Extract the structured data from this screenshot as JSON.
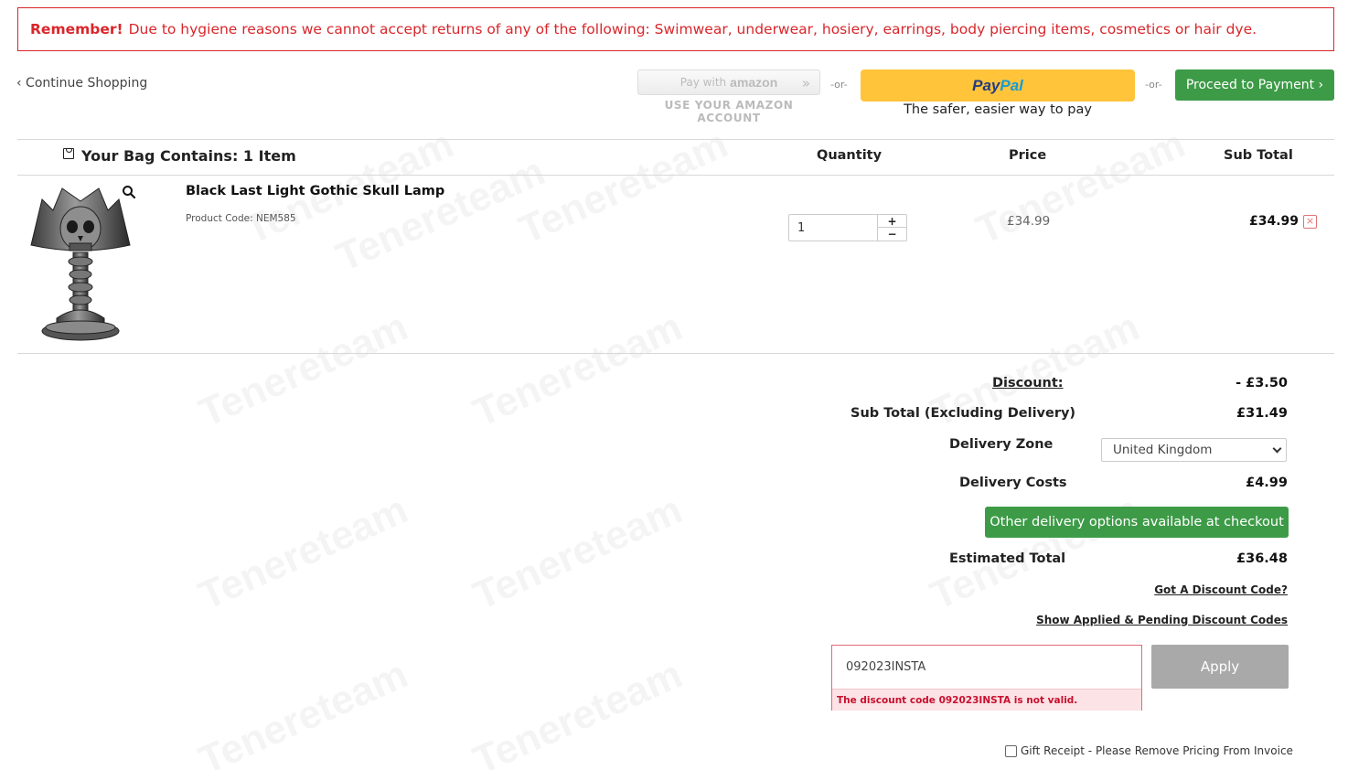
{
  "notice": {
    "bold": "Remember!",
    "text": "Due to hygiene reasons we cannot accept returns of any of the following: Swimwear, underwear, hosiery, earrings, body piercing items, cosmetics or hair dye."
  },
  "nav": {
    "continue_label": "‹ Continue Shopping"
  },
  "payment": {
    "amazon_prefix": "Pay with",
    "amazon_brand": "amazon",
    "amazon_caption": "USE YOUR AMAZON ACCOUNT",
    "or_label": "-or-",
    "paypal_pay": "Pay",
    "paypal_pal": "Pal",
    "paypal_caption": "The safer, easier way to pay",
    "proceed_label": "Proceed to Payment ›"
  },
  "bag": {
    "title": "Your Bag Contains: 1 Item",
    "col_quantity": "Quantity",
    "col_price": "Price",
    "col_subtotal": "Sub Total"
  },
  "item": {
    "name": "Black Last Light Gothic Skull Lamp",
    "code_label": "Product Code: NEM585",
    "quantity": "1",
    "price": "£34.99",
    "subtotal": "£34.99",
    "remove_icon": "×"
  },
  "summary": {
    "discount_label": "Discount:",
    "discount_value": "- £3.50",
    "subtotal_label": "Sub Total (Excluding Delivery)",
    "subtotal_value": "£31.49",
    "zone_label": "Delivery Zone",
    "zone_selected": "United Kingdom",
    "costs_label": "Delivery Costs",
    "costs_value": "£4.99",
    "other_delivery_label": "Other delivery options available at checkout",
    "estimated_label": "Estimated Total",
    "estimated_value": "£36.48"
  },
  "discount": {
    "got_code_link": "Got A Discount Code?",
    "show_applied_link": "Show Applied & Pending Discount Codes",
    "code_value": "092023INSTA",
    "error": "The discount code 092023INSTA is not valid.",
    "apply_label": "Apply"
  },
  "gift": {
    "label": "Gift Receipt - Please Remove Pricing From Invoice"
  },
  "watermark": {
    "text": "Tenereteam"
  },
  "colors": {
    "alert_red": "#d9262b",
    "green": "#3d9b47",
    "paypal_yellow": "#ffc439",
    "apply_gray": "#a9a9a9"
  },
  "icons": {
    "zoom": "search-icon",
    "remove": "close-icon",
    "bag": "bag-icon",
    "caret": "chevron-down-icon"
  }
}
